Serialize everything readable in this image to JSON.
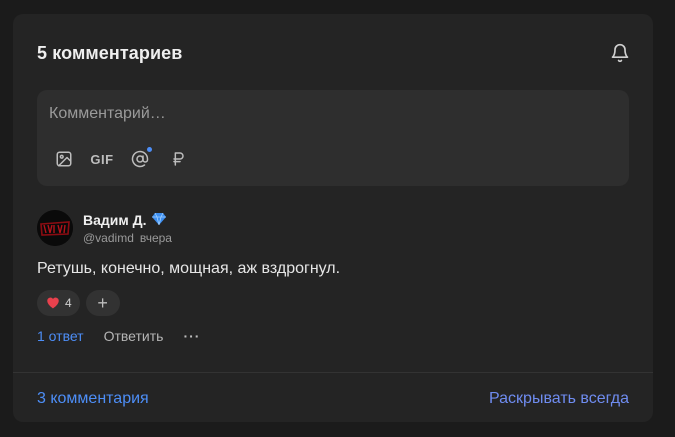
{
  "comments": {
    "title": "5 комментариев",
    "composer": {
      "placeholder": "Комментарий…"
    },
    "tools": [
      "image-icon",
      "gif-button",
      "mention-icon",
      "ruble-icon"
    ],
    "gif_label": "GIF",
    "comment": {
      "author": "Вадим Д.",
      "handle": "@vadimd",
      "time": "вчера",
      "text": "Ретушь, конечно, мощная, аж вздрогнул.",
      "reactions": [
        {
          "emoji": "❤",
          "count": "4"
        }
      ],
      "add_reaction": "+",
      "reply_count": "1 ответ",
      "reply_label": "Ответить",
      "more_label": "···"
    },
    "footer": {
      "more_comments": "3 комментария",
      "expand_always": "Раскрывать всегда"
    },
    "colors": {
      "accent": "#4d8ef7",
      "card": "#242424",
      "heart": "#e8414d"
    },
    "icons": {
      "bell": "bell-icon",
      "badge": "diamond-icon"
    }
  }
}
